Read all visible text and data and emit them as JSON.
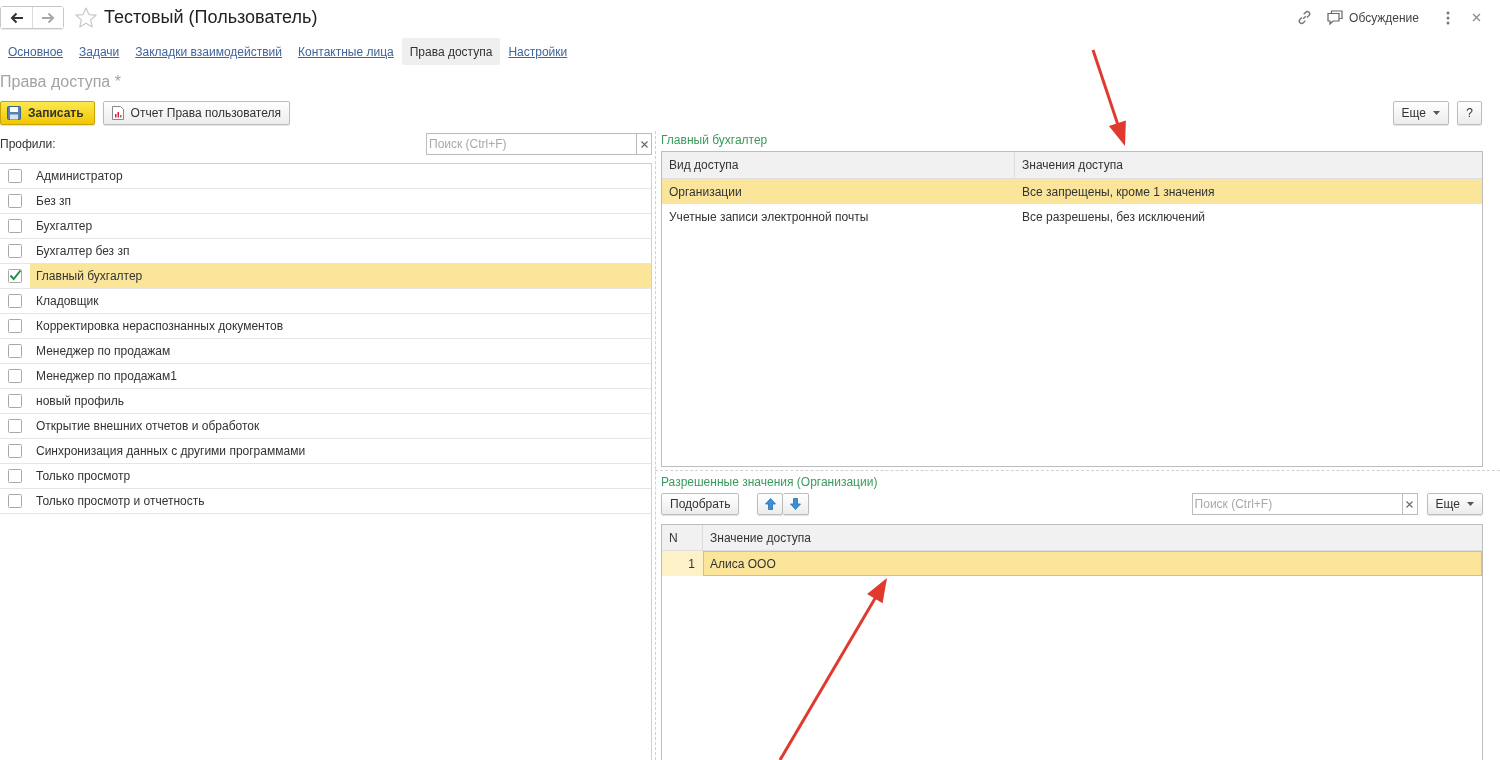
{
  "window": {
    "navigation": [
      {
        "kind": "back",
        "disabled": false
      },
      {
        "kind": "forward",
        "disabled": true
      }
    ],
    "favorite": false,
    "title": "Тестовый (Пользователь)",
    "discussion": "Обсуждение"
  },
  "tabs": [
    {
      "label": "Основное",
      "selected": false
    },
    {
      "label": "Задачи",
      "selected": false
    },
    {
      "label": "Закладки взаимодействий",
      "selected": false
    },
    {
      "label": "Контактные лица",
      "selected": false
    },
    {
      "label": "Права доступа",
      "selected": true
    },
    {
      "label": "Настройки",
      "selected": false
    }
  ],
  "heading": "Права доступа *",
  "toolbar": {
    "buttons": [
      {
        "label": "Записать",
        "kind": "primary"
      },
      {
        "label": "Отчет Права пользователя",
        "kind": "report"
      }
    ],
    "more": "Еще",
    "help": "?"
  },
  "profiles": {
    "label": "Профили:",
    "search": {
      "placeholder": "Поиск (Ctrl+F)"
    },
    "items": [
      {
        "name": "Администратор",
        "checked": false,
        "selected": false
      },
      {
        "name": "Без зп",
        "checked": false,
        "selected": false
      },
      {
        "name": "Бухгалтер",
        "checked": false,
        "selected": false
      },
      {
        "name": "Бухгалтер без зп",
        "checked": false,
        "selected": false
      },
      {
        "name": "Главный бухгалтер",
        "checked": true,
        "selected": true
      },
      {
        "name": "Кладовщик",
        "checked": false,
        "selected": false
      },
      {
        "name": "Корректировка нераспознанных документов",
        "checked": false,
        "selected": false
      },
      {
        "name": "Менеджер по продажам",
        "checked": false,
        "selected": false
      },
      {
        "name": "Менеджер по продажам1",
        "checked": false,
        "selected": false
      },
      {
        "name": "новый профиль",
        "checked": false,
        "selected": false
      },
      {
        "name": "Открытие внешних отчетов и обработок",
        "checked": false,
        "selected": false
      },
      {
        "name": "Синхронизация данных с другими программами",
        "checked": false,
        "selected": false
      },
      {
        "name": "Только просмотр",
        "checked": false,
        "selected": false
      },
      {
        "name": "Только просмотр и отчетность",
        "checked": false,
        "selected": false
      }
    ]
  },
  "access_kinds": {
    "title": "Главный бухгалтер",
    "columns": [
      "Вид доступа",
      "Значения доступа"
    ],
    "rows": [
      {
        "cells": [
          "Организации",
          "Все запрещены, кроме 1 значения"
        ],
        "selected": true
      },
      {
        "cells": [
          "Учетные записи электронной почты",
          "Все разрешены, без исключений"
        ],
        "selected": false
      }
    ]
  },
  "allowed_values": {
    "title": "Разрешенные значения (Организации)",
    "pick_button": "Подобрать",
    "move_buttons": [
      {
        "kind": "up"
      },
      {
        "kind": "down"
      }
    ],
    "search": {
      "placeholder": "Поиск (Ctrl+F)"
    },
    "more": "Еще",
    "columns": [
      "N",
      "Значение доступа"
    ],
    "rows": [
      {
        "cells": [
          "1",
          "Алиса ООО"
        ],
        "selected": true
      }
    ]
  },
  "annotations": [
    {
      "kind": "arrow"
    },
    {
      "kind": "arrow"
    }
  ]
}
